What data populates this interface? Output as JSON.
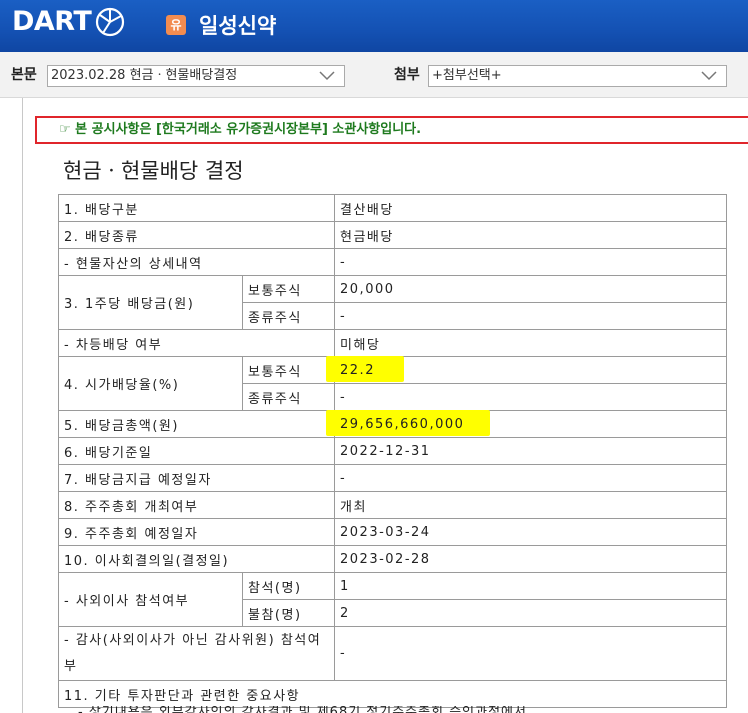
{
  "header": {
    "logo_text": "DART",
    "corp_badge": "유",
    "corp_name": "일성신약"
  },
  "selector": {
    "body_label": "본문",
    "body_value": "2023.02.28  현금ㆍ현물배당결정",
    "attach_label": "첨부",
    "attach_value": "+첨부선택+"
  },
  "notice": "☞ 본 공시사항은 [한국거래소 유가증권시장본부] 소관사항입니다.",
  "doc_title": "현금ㆍ현물배당 결정",
  "table": {
    "r1": {
      "label": "1. 배당구분",
      "value": "결산배당"
    },
    "r2": {
      "label": "2. 배당종류",
      "value": "현금배당"
    },
    "r3": {
      "label": "- 현물자산의 상세내역",
      "value": "-"
    },
    "r4": {
      "label": "3. 1주당 배당금(원)",
      "sub1": "보통주식",
      "val1": "20,000",
      "sub2": "종류주식",
      "val2": "-"
    },
    "r5": {
      "label": "- 차등배당 여부",
      "value": "미해당"
    },
    "r6": {
      "label": "4. 시가배당율(%)",
      "sub1": "보통주식",
      "val1": "22.2",
      "sub2": "종류주식",
      "val2": "-"
    },
    "r7": {
      "label": "5. 배당금총액(원)",
      "value": "29,656,660,000"
    },
    "r8": {
      "label": "6. 배당기준일",
      "value": "2022-12-31"
    },
    "r9": {
      "label": "7. 배당금지급 예정일자",
      "value": "-"
    },
    "r10": {
      "label": "8. 주주총회 개최여부",
      "value": "개최"
    },
    "r11": {
      "label": "9. 주주총회 예정일자",
      "value": "2023-03-24"
    },
    "r12": {
      "label": "10. 이사회결의일(결정일)",
      "value": "2023-02-28"
    },
    "r13": {
      "label": "- 사외이사 참석여부",
      "sub1": "참석(명)",
      "val1": "1",
      "sub2": "불참(명)",
      "val2": "2"
    },
    "r14": {
      "label": "- 감사(사외이사가 아닌 감사위원) 참석여부",
      "value": "-"
    },
    "r15": {
      "label": "11. 기타 투자판단과 관련한 중요사항"
    }
  },
  "cutoff_text": "- 상기내용은 외부감사인의 감사결과 및 제68기 정기주주총회 승인과정에서"
}
